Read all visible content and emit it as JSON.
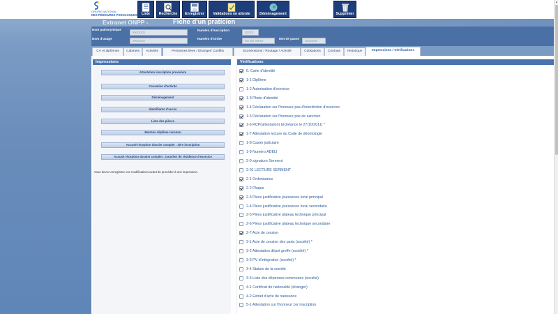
{
  "header": {
    "logo_line1": "ORDRE NATIONAL",
    "logo_line2": "DES PÉDICURES-PODOLOGUES",
    "nav": [
      {
        "label": "Liste",
        "icon": "list-icon"
      },
      {
        "label": "Recherche",
        "icon": "search-icon"
      },
      {
        "label": "Enregistrer",
        "icon": "save-icon"
      },
      {
        "label": "Validations en attente",
        "icon": "validation-icon"
      },
      {
        "label": "Déménagement",
        "icon": "globe-icon"
      },
      {
        "label": "Supprimer",
        "icon": "trash-icon"
      }
    ]
  },
  "title": {
    "prefix": "Extranet ONPP -",
    "main": "Fiche d'un praticien"
  },
  "info": {
    "nom_patronymique_label": "Nom patronymique",
    "nom_patronymique_value": "XXXXXX",
    "nom_usage_label": "Nom d'usage",
    "nom_usage_value": "XXXXXX",
    "num_inscription_label": "Numéro d'inscription",
    "num_inscription_value": "XXXX",
    "num_ordre_label": "Numéro d'Ordre",
    "num_ordre_value": "XX XX XXXX",
    "mot_de_passe_label": "Mot de passe",
    "mot_de_passe_value": "XXXXXX"
  },
  "tabs": [
    {
      "label": "CV et diplômes",
      "active": false
    },
    {
      "label": "Cabinets",
      "active": false
    },
    {
      "label": "Activités",
      "active": false
    },
    {
      "label": "Personnes liées / Etranger/ Conflits",
      "active": false
    },
    {
      "label": "Exonérations / Routage / Activité",
      "active": false
    },
    {
      "label": "Cotisations",
      "active": false
    },
    {
      "label": "Contrats",
      "active": false
    },
    {
      "label": "Historique",
      "active": false
    },
    {
      "label": "Impressions / Vérifications",
      "active": true
    }
  ],
  "impressions": {
    "heading": "Impressions",
    "buttons": [
      "Attestation inscription provisoire",
      "Cessation d'activité",
      "Déménagement",
      "Identifiants d'accès",
      "Liste des pièces",
      "Mention diplôme reconnu",
      "Accusé réception dossier complet : 1ère inscription",
      "Accusé réception dossier complet : transfert de résidence d'exercice"
    ],
    "note": "Vous devez enregistrer vos modifications avant de procéder à une impression."
  },
  "verifications": {
    "heading": "Vérifications",
    "items": [
      {
        "label": "0. Carte d'identité",
        "checked": true
      },
      {
        "label": "1-1 Diplôme",
        "checked": true
      },
      {
        "label": "1-2 Autorisation d'exercice",
        "checked": false
      },
      {
        "label": "1-3 Photo d'identité",
        "checked": true
      },
      {
        "label": "1-4 Déclaration sur l'honneur pas d'interdiction d'exercice",
        "checked": true
      },
      {
        "label": "1-5 Déclaration sur l'honneur pas de sanction",
        "checked": true
      },
      {
        "label": "1-6 RCP(attestation) (échéance le 27/10/2011) *",
        "checked": true
      },
      {
        "label": "1-7 Attestation lecture du Code de déontologie",
        "checked": true
      },
      {
        "label": "1-8 Casier judiciaire",
        "checked": false
      },
      {
        "label": "1-9 Numéro ADELI",
        "checked": false
      },
      {
        "label": "2-0 signature Serment",
        "checked": false
      },
      {
        "label": "2-01 LECTURE SERMENT",
        "checked": false
      },
      {
        "label": "2-1 Ordonnance",
        "checked": true
      },
      {
        "label": "2-2 Plaque",
        "checked": true
      },
      {
        "label": "2-3 Pièce justificative jouissance local principal",
        "checked": true
      },
      {
        "label": "2-4 Pièce justificative jouissance local secondaire",
        "checked": false
      },
      {
        "label": "2-5 Pièce justificative plateau technique principal",
        "checked": false
      },
      {
        "label": "2-6 Pièce justificative plateau technique secondaire",
        "checked": false
      },
      {
        "label": "2-7 Acte de cession",
        "checked": true
      },
      {
        "label": "3-1 Acte de cession des parts (société) *",
        "checked": false
      },
      {
        "label": "3-2 Attestation dépot greffe (société) *",
        "checked": false
      },
      {
        "label": "3-3 PV d'intégration (société) *",
        "checked": false
      },
      {
        "label": "3-4 Statuts de la société",
        "checked": false
      },
      {
        "label": "3-5 Liste des dépenses communes (société)",
        "checked": false
      },
      {
        "label": "4-1 Certificat de nationalité (étranger)",
        "checked": false
      },
      {
        "label": "4-2 Extrait d'acte de naissance",
        "checked": false
      },
      {
        "label": "5-1 Attestation sur l'honneur 1er inscription",
        "checked": false
      }
    ]
  },
  "colors": {
    "nav_bg": "#1d3e7a",
    "accent": "#4a73ae",
    "link_text": "#2f5c99"
  }
}
